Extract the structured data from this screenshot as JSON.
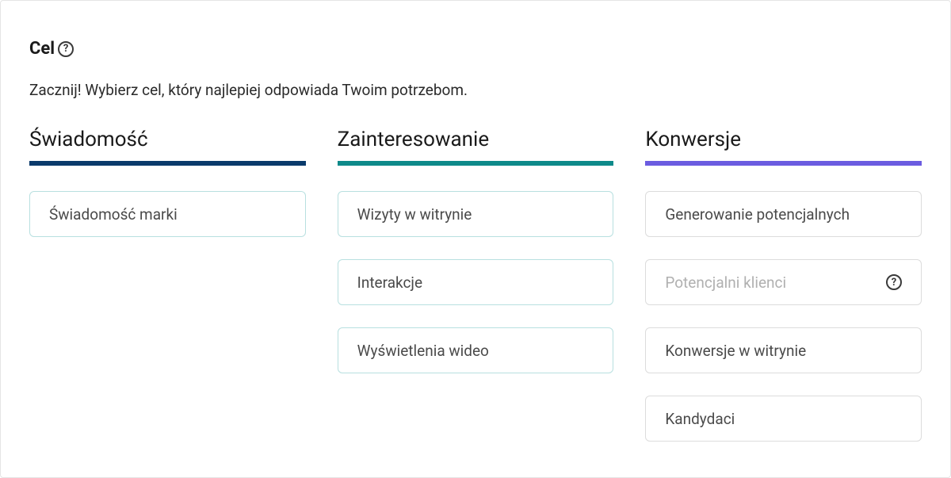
{
  "header": {
    "title": "Cel"
  },
  "subtitle": "Zacznij! Wybierz cel, który najlepiej odpowiada Twoim potrzebom.",
  "columns": {
    "awareness": {
      "heading": "Świadomość",
      "items": [
        "Świadomość marki"
      ]
    },
    "interest": {
      "heading": "Zainteresowanie",
      "items": [
        "Wizyty w witrynie",
        "Interakcje",
        "Wyświetlenia wideo"
      ]
    },
    "conversion": {
      "heading": "Konwersje",
      "items": [
        "Generowanie potencjalnych",
        "Potencjalni klienci",
        "Konwersje w witrynie",
        "Kandydaci"
      ]
    }
  }
}
